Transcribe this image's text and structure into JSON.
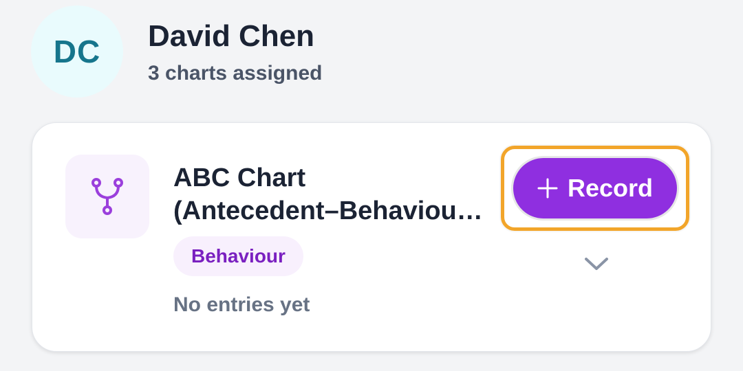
{
  "user": {
    "initials": "DC",
    "name": "David Chen",
    "subtitle": "3 charts assigned"
  },
  "chart_card": {
    "icon": "branch-fork-icon",
    "title_line1": "ABC Chart",
    "title_line2": "(Antecedent–Behaviou…",
    "tag": "Behaviour",
    "entries_text": "No entries yet",
    "record_icon": "plus-icon",
    "record_label": "Record",
    "expand_icon": "chevron-down-icon"
  },
  "colors": {
    "accent": "#8f2fe0",
    "focus_ring": "#f2a52a",
    "avatar_bg": "#e9fbfd",
    "avatar_text": "#16758c",
    "tag_bg": "#f8f0fd",
    "tag_text": "#7a20c0"
  }
}
